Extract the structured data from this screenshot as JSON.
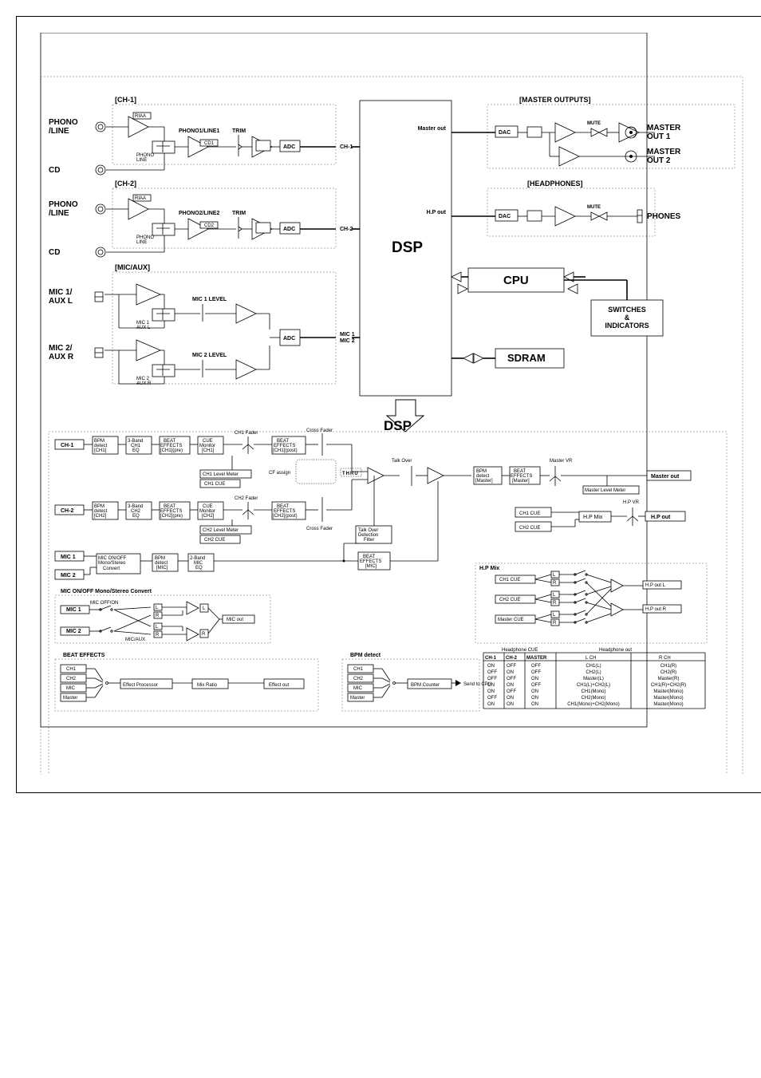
{
  "inputs": {
    "phono_line": "PHONO\n/LINE",
    "cd": "CD",
    "mic1_auxl": "MIC 1/\nAUX L",
    "mic2_auxr": "MIC 2/\nAUX R"
  },
  "sections": {
    "ch1": "[CH-1]",
    "ch2": "[CH-2]",
    "mic_aux": "[MIC/AUX]",
    "master_outputs": "[MASTER OUTPUTS]",
    "headphones": "[HEADPHONES]"
  },
  "outputs": {
    "master_out1": "MASTER\nOUT 1",
    "master_out2": "MASTER\nOUT 2",
    "phones": "PHONES"
  },
  "blocks": {
    "riaa": "RIAA",
    "phono1_line1": "PHONO1/LINE1",
    "phono2_line2": "PHONO2/LINE2",
    "cd1": "CD1",
    "cd2": "CD2",
    "trim": "TRIM",
    "adc": "ADC",
    "ch1_label": "CH-1",
    "ch2_label": "CH-2",
    "mic1_mic2": "MIC 1\nMIC 2",
    "mic1_level": "MIC 1 LEVEL",
    "mic2_level": "MIC 2 LEVEL",
    "master_out": "Master out",
    "hp_out": "H.P out",
    "dac": "DAC",
    "mute": "MUTE",
    "dsp": "DSP",
    "cpu": "CPU",
    "sdram": "SDRAM",
    "switches": "SWITCHES\n&\nINDICATORS"
  },
  "switches": {
    "phono_line_sw": "PHONO\nLINE",
    "mic1_auxl_sw": "MIC 1\nAUX L",
    "mic2_auxr_sw": "MIC 2\nAUX R"
  },
  "dsp_flow": {
    "title": "DSP",
    "ch1": "CH-1",
    "ch2": "CH-2",
    "mic1": "MIC 1",
    "mic2": "MIC 2",
    "bpm_detect_ch1": "BPM\ndetect\n[CH1]",
    "bpm_detect_ch2": "BPM\ndetect\n[CH2]",
    "bpm_detect_mic": "BPM\ndetect\n[MIC]",
    "bpm_detect_master": "BPM\ndetect\n[Master]",
    "3band_ch1_eq": "3-Band\nCH1\nEQ",
    "3band_ch2_eq": "3-Band\nCH2\nEQ",
    "2band_mic_eq": "2-Band\nMIC\nEQ",
    "beat_effects_ch1_pre": "BEAT\nEFFECTS\n[CH1](pre)",
    "beat_effects_ch2_pre": "BEAT\nEFFECTS\n[CH2](pre)",
    "beat_effects_ch1_post": "BEAT\nEFFECTS\n[CH1](post)",
    "beat_effects_ch2_post": "BEAT\nEFFECTS\n[CH2](post)",
    "beat_effects_master": "BEAT\nEFFECTS\n[Master]",
    "beat_effects_mic": "BEAT\nEFFECTS\n[MIC]",
    "cue_monitor_ch1": "CUE\nMonitor\n[CH1]",
    "cue_monitor_ch2": "CUE\nMonitor\n[CH2]",
    "ch1_fader": "CH1 Fader",
    "ch2_fader": "CH2 Fader",
    "cross_fader": "Cross Fader",
    "cf_assign": "CF assign",
    "thru": "THRU",
    "ch1_level_meter": "CH1 Level Meter",
    "ch2_level_meter": "CH2 Level Meter",
    "ch1_cue": "CH1 CUE",
    "ch2_cue": "CH2 CUE",
    "talk_over": "Talk Over",
    "talk_over_detection": "Talk Over\nDetection\nFilter",
    "mic_onoff_mono_stereo": "MIC ON/OFF\nMono/Stereo\nConvert",
    "master_vr": "Master VR",
    "master_level_meter": "Master Level Meter",
    "hp_vr": "H.P VR",
    "hp_mix": "H.P Mix",
    "hp_mix_title": "H.P Mix",
    "master_cue": "Master CUE",
    "hp_out_l": "H.P out L",
    "hp_out_r": "H.P out R",
    "headphone_cue": "Headphone CUE",
    "headphone_out": "Headphone out"
  },
  "mic_convert": {
    "title": "MIC ON/OFF Mono/Stereo Convert",
    "mic_off_on": "MIC OFF/ON",
    "l": "L",
    "r": "R",
    "micaux": "MIC/AUX",
    "mic_out": "MIC out"
  },
  "beat_effects": {
    "title": "BEAT EFFECTS",
    "ch1": "CH1",
    "ch2": "CH2",
    "mic": "MIC",
    "master": "Master",
    "effect_processor": "Effect Processor",
    "mix_ratio": "Mix Ratio",
    "effect_out": "Effect out"
  },
  "bpm_detect": {
    "title": "BPM detect",
    "bpm_counter": "BPM Counter",
    "send_to_cpu": "Send to CPU"
  },
  "hp_table": {
    "headers": {
      "col1": "CH-1",
      "col2": "CH-2",
      "col3": "MASTER",
      "lch": "L CH",
      "rch": "R CH"
    },
    "rows": [
      {
        "c1": "ON",
        "c2": "OFF",
        "c3": "OFF",
        "l": "CH1(L)",
        "r": "CH1(R)"
      },
      {
        "c1": "OFF",
        "c2": "ON",
        "c3": "OFF",
        "l": "CH2(L)",
        "r": "CH2(R)"
      },
      {
        "c1": "OFF",
        "c2": "OFF",
        "c3": "ON",
        "l": "Master(L)",
        "r": "Master(R)"
      },
      {
        "c1": "ON",
        "c2": "ON",
        "c3": "OFF",
        "l": "CH1(L)+CH2(L)",
        "r": "CH1(R)+CH2(R)"
      },
      {
        "c1": "ON",
        "c2": "OFF",
        "c3": "ON",
        "l": "CH1(Mono)",
        "r": "Master(Mono)"
      },
      {
        "c1": "OFF",
        "c2": "ON",
        "c3": "ON",
        "l": "CH2(Mono)",
        "r": "Master(Mono)"
      },
      {
        "c1": "ON",
        "c2": "ON",
        "c3": "ON",
        "l": "CH1(Mono)+CH2(Mono)",
        "r": "Master(Mono)"
      }
    ]
  }
}
